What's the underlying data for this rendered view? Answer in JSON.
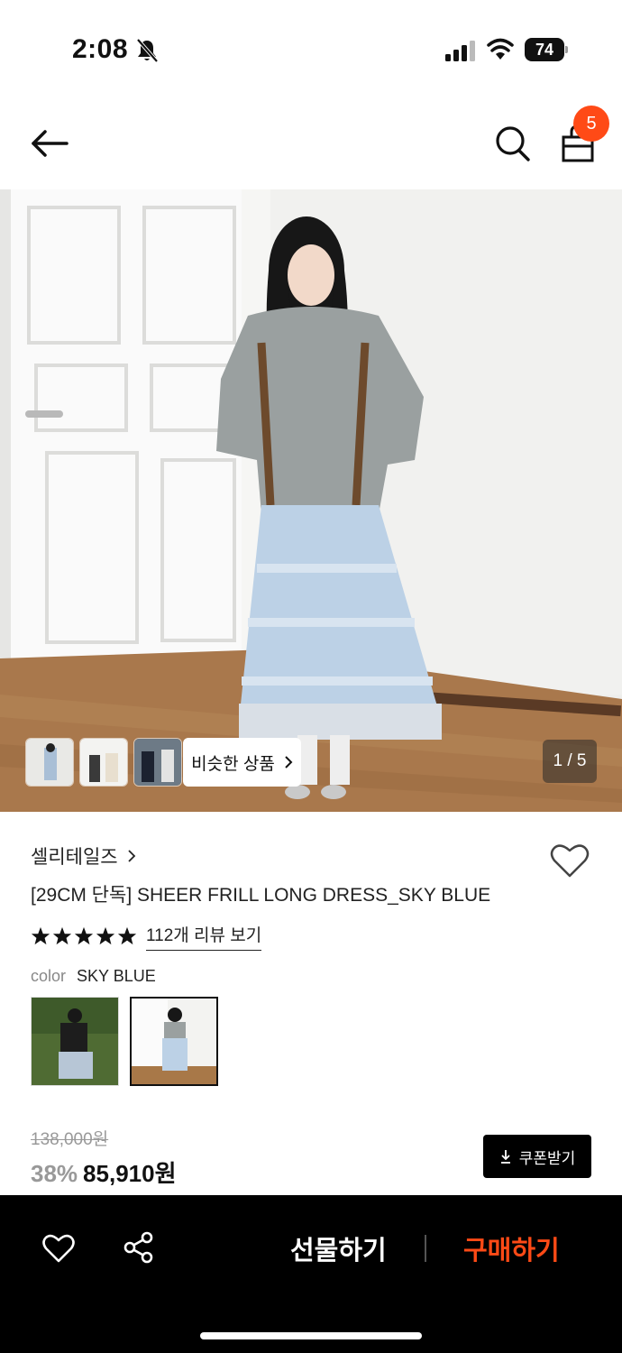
{
  "status_bar": {
    "time": "2:08",
    "battery": "74"
  },
  "nav": {
    "cart_count": "5"
  },
  "hero": {
    "similar_button_label": "비슷한 상품",
    "page_indicator": "1 / 5"
  },
  "product": {
    "brand": "셀리테일즈",
    "title": "[29CM 단독] SHEER FRILL LONG DRESS_SKY BLUE",
    "rating_stars": 5,
    "review_link": "112개 리뷰 보기",
    "color_label": "color",
    "color_value": "SKY BLUE",
    "original_price": "138,000원",
    "discount": "38%",
    "sale_price": "85,910원",
    "coupon_button": "쿠폰받기"
  },
  "bottom_bar": {
    "gift_label": "선물하기",
    "buy_label": "구매하기"
  },
  "colors": {
    "accent": "#ff4a16",
    "bar_bg": "#000000"
  }
}
